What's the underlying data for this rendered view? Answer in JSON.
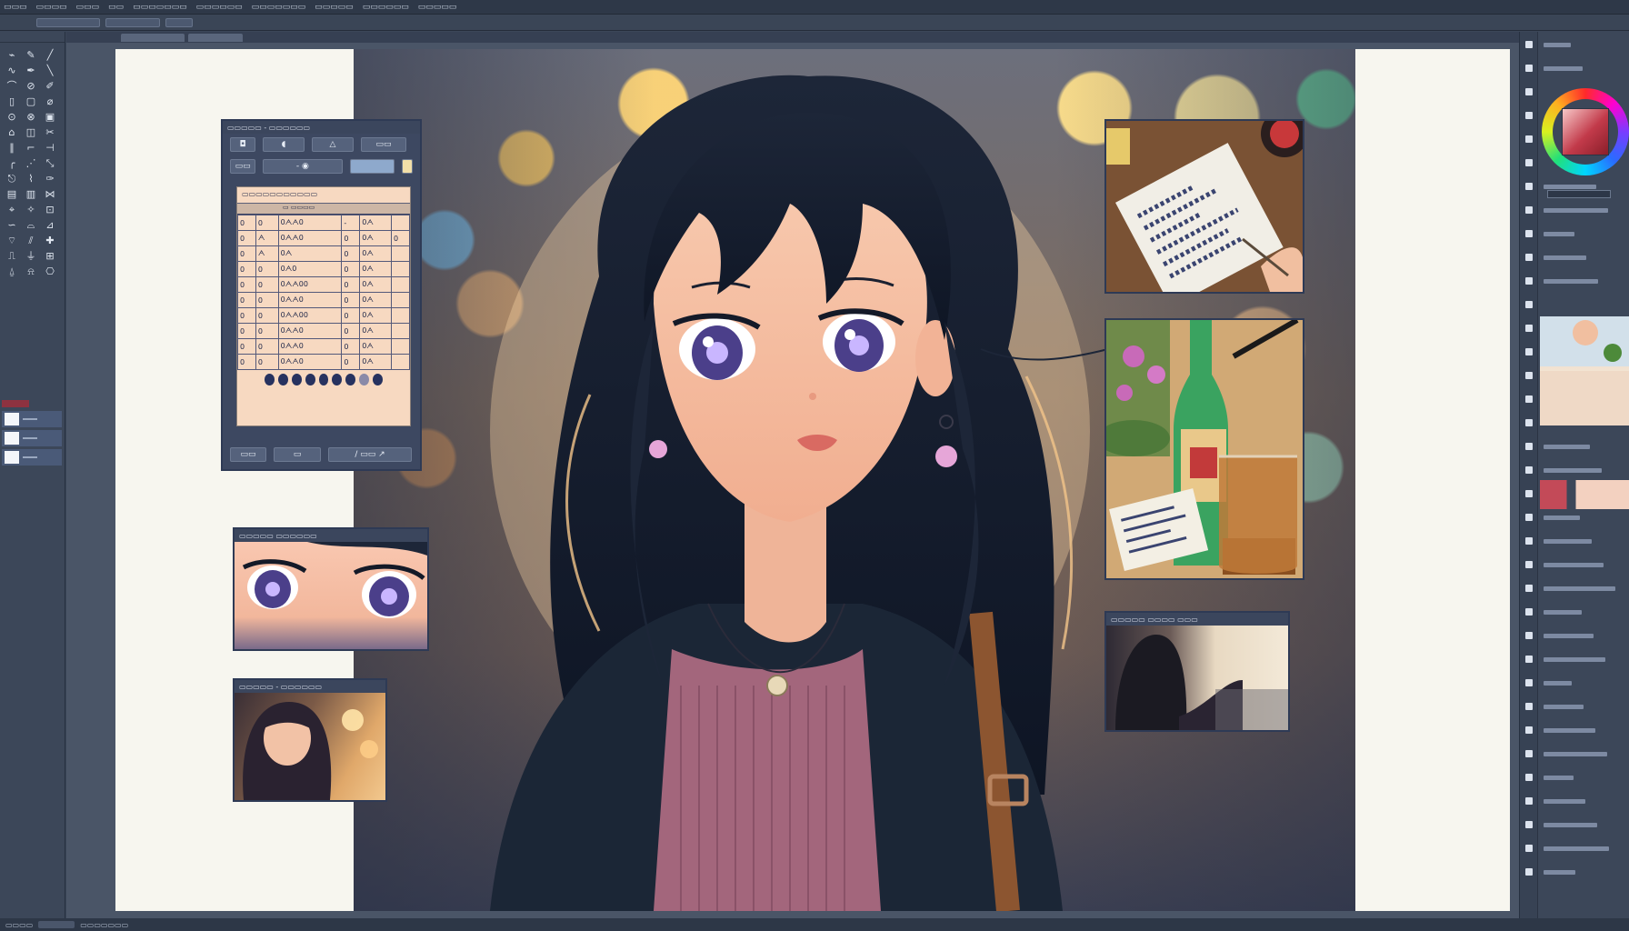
{
  "menu": {
    "items": [
      "▭▭▭",
      "▭▭▭▭",
      "▭▭▭",
      "▭▭",
      "▭▭▭▭▭▭▭",
      "▭▭▭▭▭▭",
      "▭▭▭▭▭▭▭",
      "▭▭▭▭▭",
      "▭▭▭▭▭▭",
      "▭▭▭▭▭"
    ]
  },
  "toolbox": {
    "tools": [
      "⌁",
      "✎",
      "╱",
      "∿",
      "✒",
      "╲",
      "⌒",
      "⊘",
      "✐",
      "▯",
      "▢",
      "⌀",
      "⊙",
      "⊗",
      "▣",
      "⌂",
      "◫",
      "✂",
      "∥",
      "⌐",
      "⊣",
      "╭",
      "⋰",
      "⤡",
      "⎋",
      "⌇",
      "✑",
      "▤",
      "▥",
      "⋈",
      "⌖",
      "✧",
      "⊡",
      "∽",
      "⌓",
      "⊿",
      "⌔",
      "⫽",
      "✚",
      "⎍",
      "⏚",
      "⊞",
      "⍙",
      "⍾",
      "⎔"
    ],
    "swatches": [
      "Layer 1",
      "Layer 2",
      "Layer 3"
    ]
  },
  "table_window": {
    "title": "▭▭▭▭▭ - ▭▭▭▭▭▭",
    "sheet_title": "▭▭▭▭▭▭▭▭▭▭▭",
    "rows": [
      [
        "0",
        "0",
        "0ᗅᗅ0",
        "-",
        "0ᗅ",
        ""
      ],
      [
        "0",
        "ᗅ",
        "0ᗅᗅ0",
        "0",
        "0ᗅ",
        "0"
      ],
      [
        "0",
        "ᗅ",
        "0ᗅ",
        "0",
        "0ᗅ",
        ""
      ],
      [
        "0",
        "0",
        "0ᗅ0",
        "0",
        "0ᗅ",
        ""
      ],
      [
        "0",
        "0",
        "0ᗅᗅ00",
        "0",
        "0ᗅ",
        ""
      ],
      [
        "0",
        "0",
        "0ᗅᗅ0",
        "0",
        "0ᗅ",
        ""
      ],
      [
        "0",
        "0",
        "0ᗅᗅ00",
        "0",
        "0ᗅ",
        ""
      ],
      [
        "0",
        "0",
        "0ᗅᗅ0",
        "0",
        "0ᗅ",
        ""
      ],
      [
        "0",
        "0",
        "0ᗅᗅ0",
        "0",
        "0ᗅ",
        ""
      ],
      [
        "0",
        "0",
        "0ᗅᗅ0",
        "0",
        "0ᗅ",
        ""
      ]
    ]
  },
  "eyes_window": {
    "title": "▭▭▭▭▭ ▭▭▭▭▭▭"
  },
  "thumb_window": {
    "title": "▭▭▭▭▭ - ▭▭▭▭▭▭"
  },
  "ref_window": {
    "title": "▭▭▭▭▭ ▭▭▭▭ ▭▭▭"
  },
  "status": {
    "zoom": "▭▭▭▭",
    "info": "▭▭▭▭▭▭▭"
  },
  "colors": {
    "accent": "#8e3240",
    "ui_bg": "#3c4759",
    "canvas": "#f7f6ef",
    "frame": "#2e3a55"
  },
  "icons": [
    "search-icon",
    "brush-icon",
    "eyedropper-icon",
    "eraser-icon",
    "color-wheel-icon"
  ]
}
